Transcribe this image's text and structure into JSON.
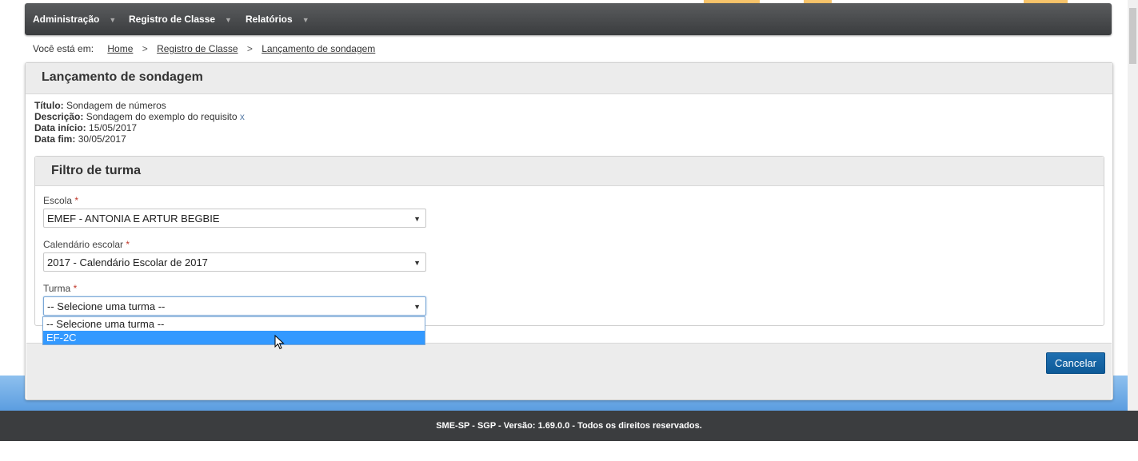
{
  "nav": {
    "items": [
      {
        "label": "Administração"
      },
      {
        "label": "Registro de Classe"
      },
      {
        "label": "Relatórios"
      }
    ],
    "caret": "▼"
  },
  "breadcrumb": {
    "prefix": "Você está em:",
    "items": [
      "Home",
      "Registro de Classe",
      "Lançamento de sondagem"
    ],
    "separator": ">"
  },
  "panel": {
    "title": "Lançamento de sondagem",
    "info": {
      "titulo_label": "Título:",
      "titulo_value": "Sondagem de números",
      "descricao_label": "Descrição:",
      "descricao_value": "Sondagem do exemplo do requisito",
      "descricao_extra": "x",
      "inicio_label": "Data início:",
      "inicio_value": "15/05/2017",
      "fim_label": "Data fim:",
      "fim_value": "30/05/2017"
    }
  },
  "filter": {
    "title": "Filtro de turma",
    "required_mark": "*",
    "escola": {
      "label": "Escola",
      "value": "EMEF - ANTONIA E ARTUR BEGBIE"
    },
    "calendario": {
      "label": "Calendário escolar",
      "value": "2017 - Calendário Escolar de 2017"
    },
    "turma": {
      "label": "Turma",
      "value": "-- Selecione uma turma --",
      "options": [
        "-- Selecione uma turma --",
        "EF-2C"
      ],
      "highlighted": 1
    },
    "arrow": "▼"
  },
  "actions": {
    "cancel_label": "Cancelar"
  },
  "footer": {
    "text": "SME-SP - SGP - Versão: 1.69.0.0 - Todos os direitos reservados."
  },
  "colors": {
    "primary_button": "#0d5a98",
    "highlight": "#3399ff",
    "footer_bg": "#3b3d3f"
  }
}
